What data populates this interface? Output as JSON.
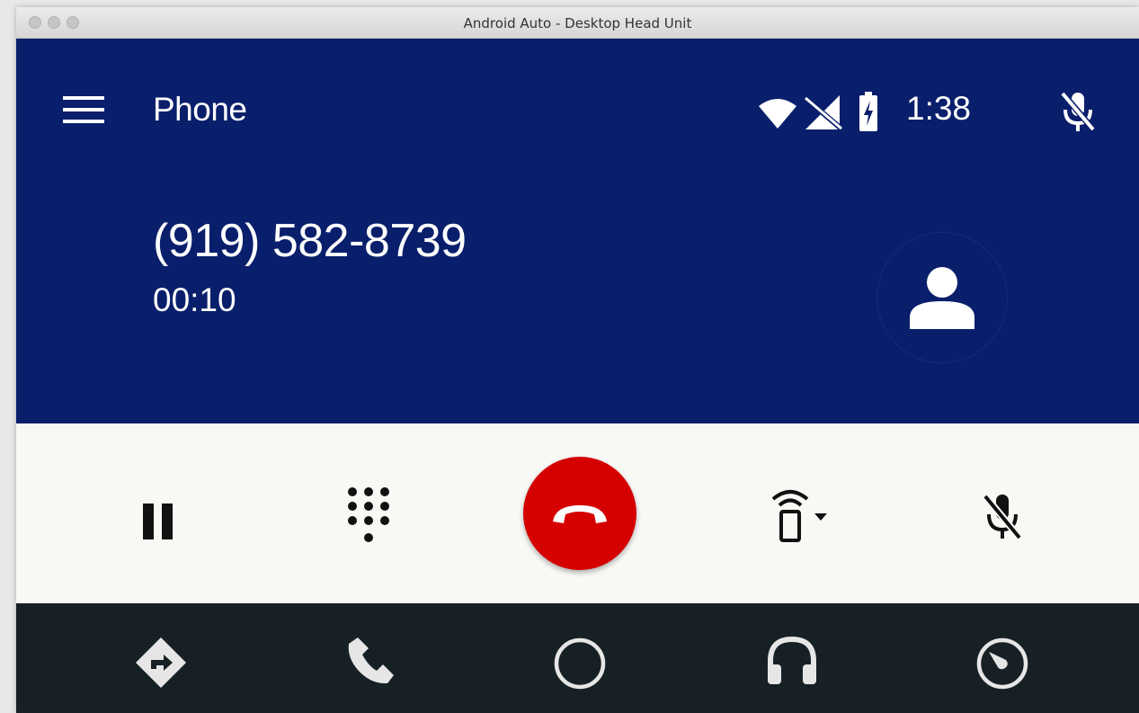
{
  "window": {
    "title": "Android Auto - Desktop Head Unit"
  },
  "header": {
    "app_title": "Phone",
    "clock": "1:38",
    "background_color": "#0a1f6b",
    "status_icons": [
      "wifi-icon",
      "no-signal-icon",
      "battery-charging-icon"
    ]
  },
  "call": {
    "phone_number": "(919) 582-8739",
    "duration": "00:10"
  },
  "controls": {
    "items": [
      "pause-icon",
      "dialpad-icon",
      "end-call-icon",
      "audio-source-icon",
      "mic-off-icon"
    ],
    "end_call_color": "#d50000"
  },
  "nav": {
    "items": [
      "navigation-icon",
      "phone-icon",
      "home-icon",
      "headphones-icon",
      "dashboard-icon"
    ],
    "background_color": "#172125"
  }
}
